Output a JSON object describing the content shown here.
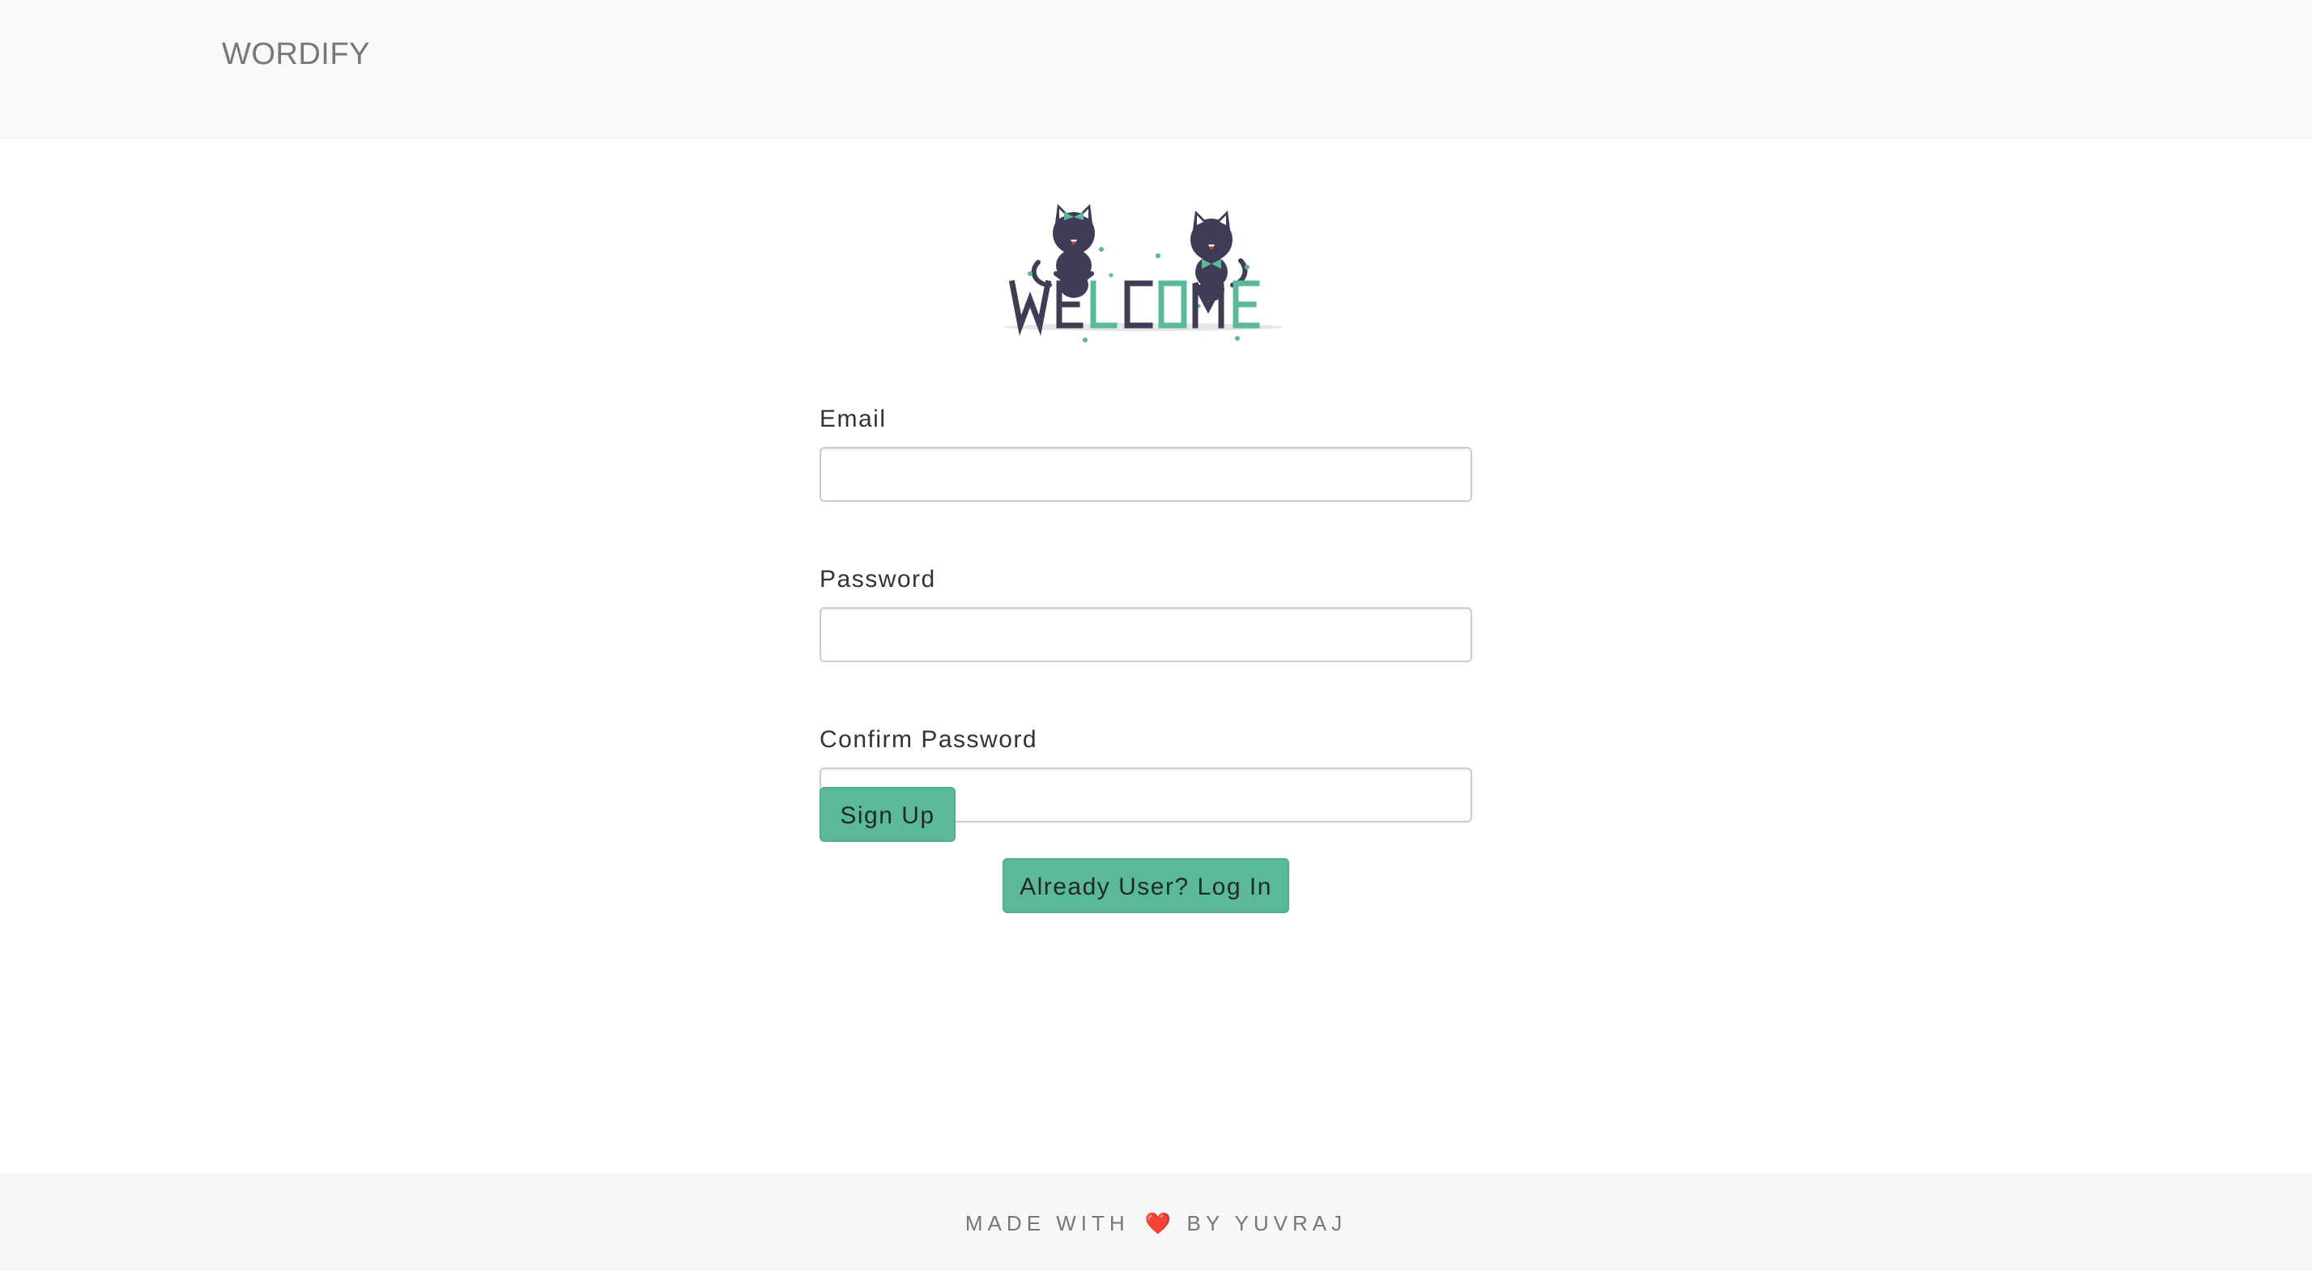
{
  "navbar": {
    "brand": "WORDIFY"
  },
  "illustration": {
    "text": "WELCOME",
    "dark_color": "#3f3d56",
    "accent_color": "#5cb89b"
  },
  "form": {
    "email_label": "Email",
    "email_value": "",
    "password_label": "Password",
    "password_value": "",
    "confirm_label": "Confirm Password",
    "confirm_value": "",
    "signup_label": "Sign Up",
    "login_label": "Already User? Log In"
  },
  "footer": {
    "prefix": "MADE WITH",
    "heart_icon": "heart-icon",
    "suffix": "BY YUVRAJ"
  },
  "colors": {
    "accent": "#5cb89b",
    "navbar_bg": "#f8f8f8",
    "heart": "#e8323e"
  }
}
